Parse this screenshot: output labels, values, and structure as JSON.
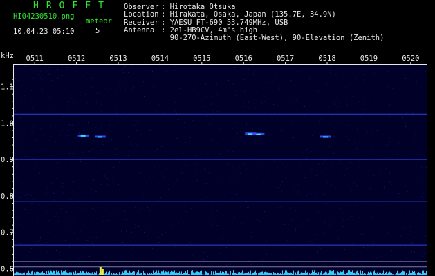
{
  "header": {
    "logo": "HROFFT",
    "filename": "HI04230510.png",
    "datetime": "10.04.23 05:10",
    "meteor_label": "meteor",
    "meteor_count": "5"
  },
  "station": [
    {
      "key": "Observer",
      "value": "Hirotaka Otsuka"
    },
    {
      "key": "Location",
      "value": "Hirakata, Osaka, Japan (135.7E, 34.9N)"
    },
    {
      "key": "Receiver",
      "value": "YAESU FT-690 53.749MHz, USB"
    },
    {
      "key": "Antenna",
      "value": "2el-HB9CV, 4m's high"
    },
    {
      "key": "",
      "value": "90-270-Azimuth (East-West), 90-Elevation (Zenith)"
    }
  ],
  "colors": {
    "text_green": "#2ee82e",
    "text_white": "#e8e8e8",
    "background": "#000028",
    "signal_blue": "#3a4cff",
    "signal_cyan": "#2ee0ff",
    "noise_floor": "#2ad0ff",
    "peak": "#f0f040"
  },
  "chart_data": {
    "type": "heatmap",
    "ylabel": "kHz",
    "x_ticks": [
      "0511",
      "0512",
      "0513",
      "0514",
      "0515",
      "0516",
      "0517",
      "0518",
      "0519",
      "0520"
    ],
    "y_ticks": [
      "1.1",
      "1.0",
      "0.9",
      "0.8",
      "0.7",
      "0.6"
    ],
    "ylim": [
      0.58,
      1.16
    ],
    "xlim_minutes": [
      10.5,
      20.4
    ],
    "carrier_lines_khz": [
      1.14,
      1.025,
      0.9,
      0.785,
      0.665,
      0.62,
      0.605
    ],
    "meteor_echoes": [
      {
        "minute": 12.1,
        "khz": 0.965
      },
      {
        "minute": 12.5,
        "khz": 0.962
      },
      {
        "minute": 16.1,
        "khz": 0.97
      },
      {
        "minute": 16.3,
        "khz": 0.969
      },
      {
        "minute": 17.9,
        "khz": 0.962
      }
    ],
    "noise_floor_level": 0.02,
    "peak_minute": 12.6
  }
}
